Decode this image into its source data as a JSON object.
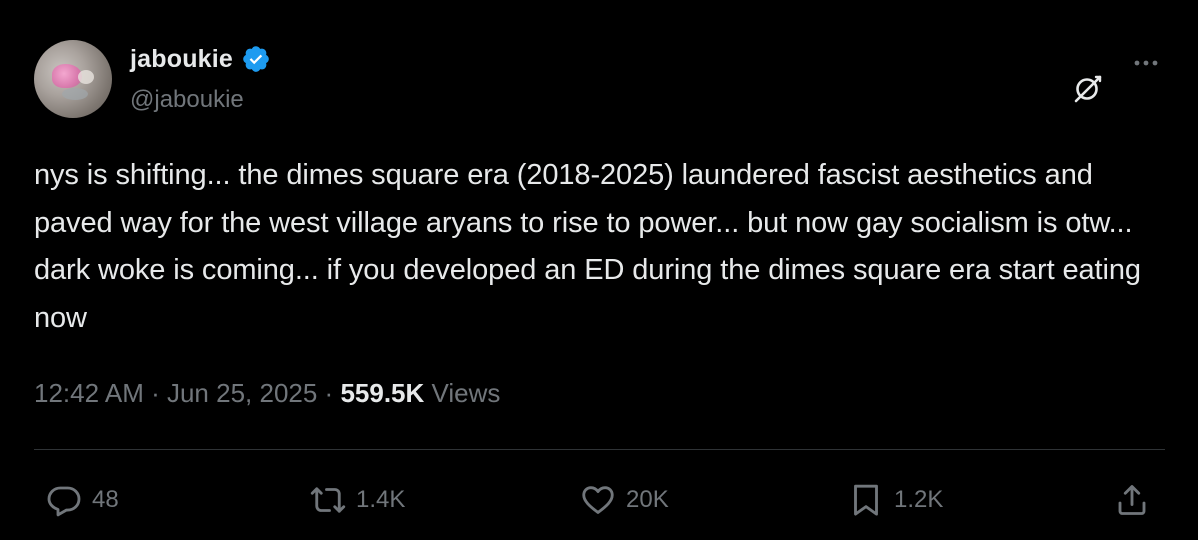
{
  "author": {
    "display_name": "jaboukie",
    "handle": "@jaboukie",
    "verified": true
  },
  "tweet": {
    "text": "nys is shifting... the dimes square era (2018-2025) laundered fascist aesthetics and paved way for the west village aryans to rise to power... but now gay socialism is otw... dark woke is coming... if you developed an ED during the dimes square era start eating now"
  },
  "meta": {
    "time": "12:42 AM",
    "separator": " · ",
    "date": "Jun 25, 2025",
    "views_count": "559.5K",
    "views_label": "Views"
  },
  "actions": {
    "replies": "48",
    "reposts": "1.4K",
    "likes": "20K",
    "bookmarks": "1.2K"
  },
  "icons": {
    "verified": "verified-badge-icon",
    "grok": "grok-icon",
    "more": "more-options-icon",
    "reply": "reply-icon",
    "repost": "repost-icon",
    "like": "heart-icon",
    "bookmark": "bookmark-icon",
    "share": "share-icon"
  },
  "colors": {
    "background": "#000000",
    "text_primary": "#e7e9ea",
    "text_secondary": "#71767b",
    "verified_blue": "#1d9bf0",
    "divider": "#2f3336"
  }
}
